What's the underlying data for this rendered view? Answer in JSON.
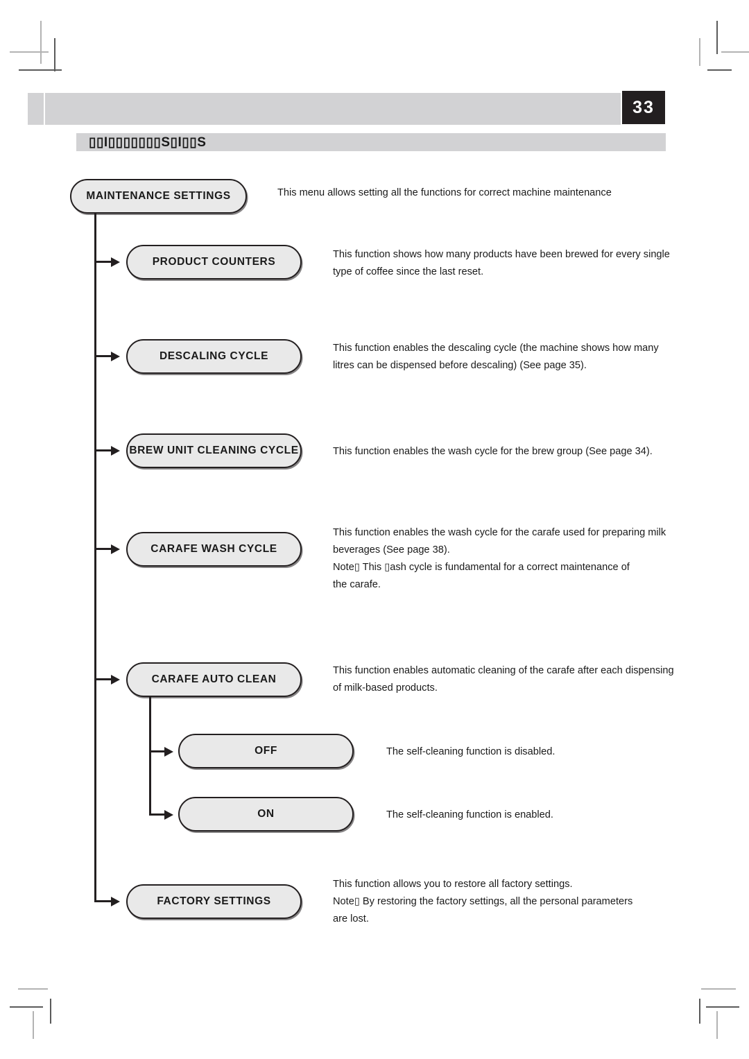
{
  "page": {
    "number": "33",
    "section_title": "▯▯I▯▯▯▯▯▯▯S▯I▯▯S"
  },
  "flow": {
    "nodes": [
      {
        "id": "maintenance-settings",
        "label": "MAINTENANCE SETTINGS",
        "description": "This menu allows setting all the functions for correct machine maintenance"
      },
      {
        "id": "product-counters",
        "label": "PRODUCT COUNTERS",
        "description": "This function shows how many products have been brewed for every single\ntype of coffee since the last reset."
      },
      {
        "id": "descaling-cycle",
        "label": "DESCALING CYCLE",
        "description": "This function enables the descaling cycle (the machine shows how many\nlitres can be dispensed before descaling) (See page 35)."
      },
      {
        "id": "brew-unit-cleaning-cycle",
        "label": "BREW UNIT CLEANING CYCLE",
        "description": "This function enables the wash cycle for the brew group (See page 34)."
      },
      {
        "id": "carafe-wash-cycle",
        "label": "CARAFE WASH CYCLE",
        "description": "This function enables the wash cycle for the carafe used for preparing milk\nbeverages (See page 38).\nNote▯ This ▯ash cycle is fundamental for a correct maintenance of\nthe carafe."
      },
      {
        "id": "carafe-auto-clean",
        "label": "CARAFE AUTO CLEAN",
        "description": "This function enables automatic cleaning of the carafe after each dispensing\nof milk-based products."
      },
      {
        "id": "carafe-auto-clean-off",
        "label": "OFF",
        "description": "The self-cleaning function is disabled."
      },
      {
        "id": "carafe-auto-clean-on",
        "label": "ON",
        "description": "The self-cleaning function is enabled."
      },
      {
        "id": "factory-settings",
        "label": "FACTORY SETTINGS",
        "description": "This function allows you to restore all factory settings.\nNote▯ By restoring the factory settings, all the personal parameters\nare lost."
      }
    ]
  },
  "colors": {
    "band_gray": "#d2d2d4",
    "pill_fill": "#e9e9e9",
    "ink": "#231f20",
    "badge_bg": "#231f20",
    "badge_text": "#ffffff"
  }
}
